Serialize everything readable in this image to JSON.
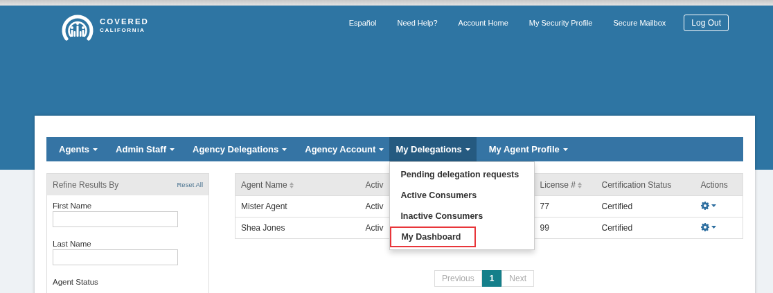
{
  "header": {
    "logo": {
      "line_1": "COVERED",
      "line_2": "CALIFORNIA"
    },
    "links": [
      "Español",
      "Need Help?",
      "Account Home",
      "My Security Profile",
      "Secure Mailbox"
    ],
    "logout": "Log Out"
  },
  "nav": {
    "items": [
      {
        "label": "Agents",
        "selected": false
      },
      {
        "label": "Admin Staff",
        "selected": false
      },
      {
        "label": "Agency Delegations",
        "selected": false
      },
      {
        "label": "Agency Account",
        "selected": false
      },
      {
        "label": "My Delegations",
        "selected": true
      },
      {
        "label": "My Agent Profile",
        "selected": false
      }
    ]
  },
  "dropdown": {
    "items": [
      {
        "label": "Pending delegation requests",
        "highlighted": false
      },
      {
        "label": "Active Consumers",
        "highlighted": false
      },
      {
        "label": "Inactive Consumers",
        "highlighted": false
      },
      {
        "label": "My Dashboard",
        "highlighted": true
      }
    ]
  },
  "filter": {
    "title": "Refine Results By",
    "reset": "Reset All",
    "fields": [
      {
        "label": "First Name"
      },
      {
        "label": "Last Name"
      }
    ],
    "agent_status_label": "Agent Status"
  },
  "table": {
    "columns": [
      {
        "label": "Agent Name",
        "sortable": true
      },
      {
        "label": "Activ",
        "sortable": false
      },
      {
        "label": "License #",
        "sortable": true
      },
      {
        "label": "Certification Status",
        "sortable": false
      },
      {
        "label": "Actions",
        "sortable": false
      }
    ],
    "rows": [
      {
        "cells": [
          "Mister Agent",
          "Activ",
          "77",
          "Certified"
        ]
      },
      {
        "cells": [
          "Shea Jones",
          "Activ",
          "99",
          "Certified"
        ]
      }
    ]
  },
  "pagination": {
    "previous": "Previous",
    "pages": [
      {
        "label": "1",
        "selected": true
      }
    ],
    "next": "Next"
  }
}
